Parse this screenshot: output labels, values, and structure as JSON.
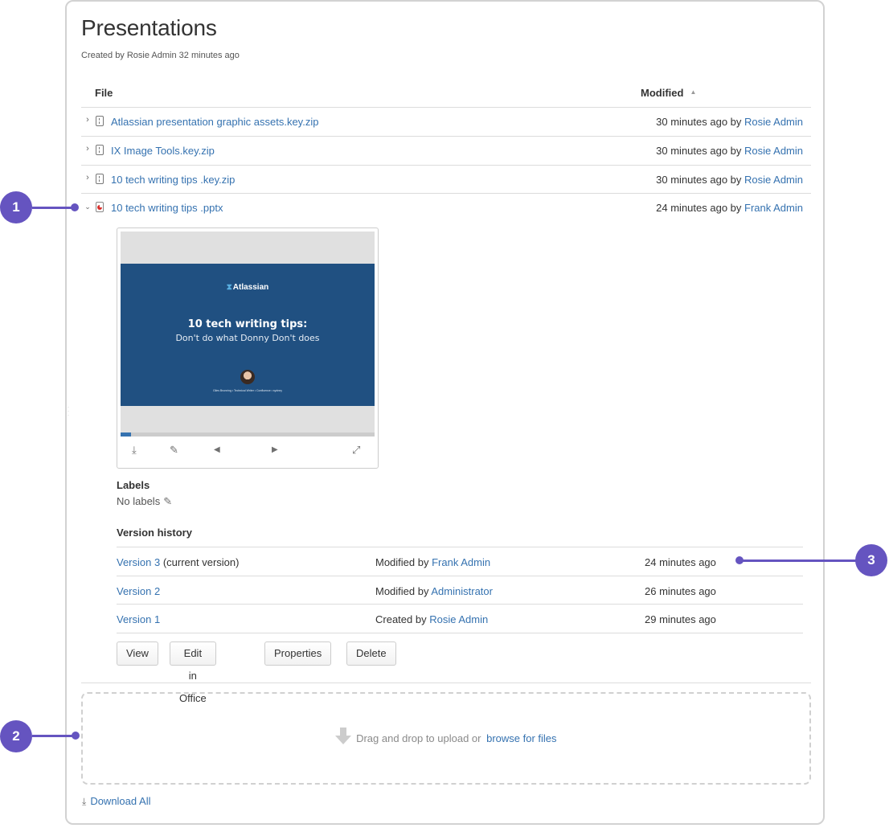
{
  "page": {
    "title": "Presentations",
    "byline": "Created by Rosie Admin 32 minutes ago"
  },
  "table": {
    "col_file": "File",
    "col_modified": "Modified",
    "sort_icon": "sort-ascending-icon",
    "rows": [
      {
        "expanded": false,
        "icon": "zip-file-icon",
        "name": "Atlassian presentation graphic assets.key.zip",
        "modified": "30 minutes ago by",
        "modified_by": "Rosie Admin"
      },
      {
        "expanded": false,
        "icon": "zip-file-icon",
        "name": "IX Image Tools.key.zip",
        "modified": "30 minutes ago by",
        "modified_by": "Rosie Admin"
      },
      {
        "expanded": false,
        "icon": "zip-file-icon",
        "name": "10 tech writing tips .key.zip",
        "modified": "30 minutes ago by",
        "modified_by": "Rosie Admin"
      },
      {
        "expanded": true,
        "icon": "powerpoint-file-icon",
        "name": "10 tech writing tips .pptx",
        "modified": "24 minutes ago by",
        "modified_by": "Frank Admin"
      }
    ]
  },
  "preview": {
    "slide_logo": "Atlassian",
    "slide_title": "10 tech writing tips:",
    "slide_subtitle": "Don't do what Donny Don't does",
    "slide_credits": "Giles Brunning  •  Technical Writer  •  Confluence  •  sydney",
    "progress_fraction": 0.04,
    "controls": {
      "download": "download-icon",
      "edit": "pencil-icon",
      "prev": "previous-slide-icon",
      "next": "next-slide-icon",
      "fullscreen": "fullscreen-icon"
    }
  },
  "details": {
    "labels_heading": "Labels",
    "labels_value": "No labels",
    "version_history_heading": "Version history",
    "versions": [
      {
        "version": "Version 3",
        "note": "(current version)",
        "action": "Modified by",
        "by": "Frank Admin",
        "when": "24 minutes ago"
      },
      {
        "version": "Version 2",
        "note": "",
        "action": "Modified by",
        "by": "Administrator",
        "when": "26 minutes ago"
      },
      {
        "version": "Version 1",
        "note": "",
        "action": "Created by",
        "by": "Rosie Admin",
        "when": "29 minutes ago"
      }
    ],
    "buttons": {
      "view": "View",
      "edit_office": "Edit in Office",
      "properties": "Properties",
      "delete": "Delete"
    }
  },
  "upload": {
    "text": "Drag and drop to upload or",
    "browse_link": "browse for files"
  },
  "download_all": "Download All",
  "callouts": [
    "1",
    "2",
    "3"
  ],
  "colors": {
    "link": "#3572b0",
    "callout": "#6554c0",
    "slide_bg": "#205081"
  }
}
